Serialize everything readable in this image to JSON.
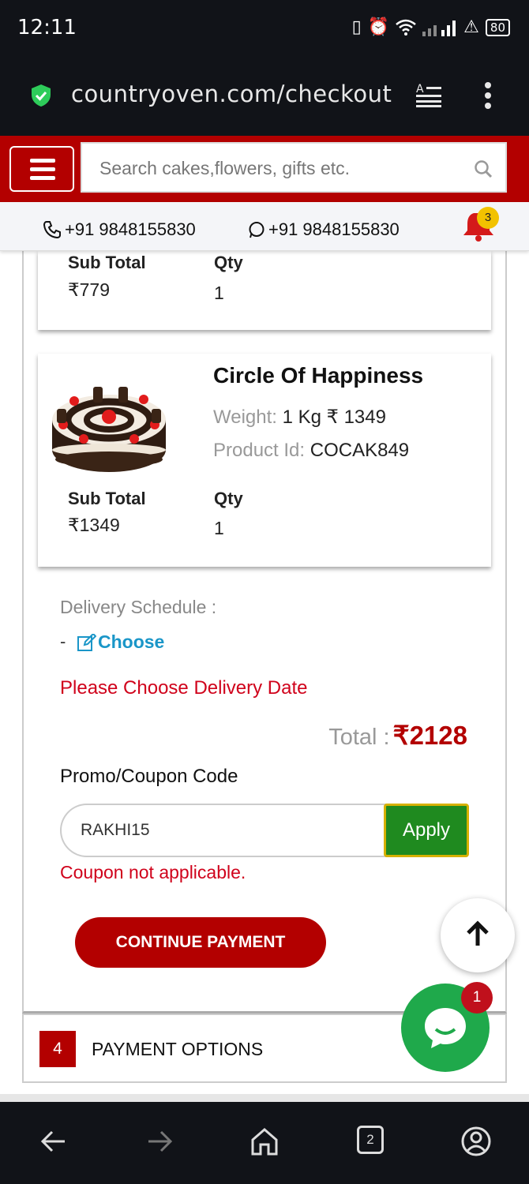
{
  "status_bar": {
    "time": "12:11",
    "battery": "80"
  },
  "browser": {
    "url": "countryoven.com/checkout"
  },
  "header": {
    "search_placeholder": "Search cakes,flowers, gifts etc."
  },
  "contact": {
    "phone": "+91 9848155830",
    "whatsapp": "+91 9848155830",
    "notification_count": "3"
  },
  "cart_items": [
    {
      "subtotal_label": "Sub Total",
      "subtotal": "₹779",
      "qty_label": "Qty",
      "qty": "1"
    },
    {
      "name": "Circle Of Happiness",
      "weight_label": "Weight:",
      "weight": "1 Kg ₹ 1349",
      "product_id_label": "Product Id:",
      "product_id": "COCAK849",
      "subtotal_label": "Sub Total",
      "subtotal": "₹1349",
      "qty_label": "Qty",
      "qty": "1"
    }
  ],
  "delivery": {
    "label": "Delivery Schedule :",
    "dash": "-",
    "choose_label": "Choose",
    "warning": "Please Choose Delivery Date"
  },
  "total": {
    "label": "Total :",
    "value": "₹2128"
  },
  "promo": {
    "label": "Promo/Coupon Code",
    "value": "RAKHI15",
    "apply_label": "Apply",
    "error": "Coupon not applicable."
  },
  "continue_label": "CONTINUE PAYMENT",
  "payment_section": {
    "step": "4",
    "title": "PAYMENT OPTIONS"
  },
  "chat": {
    "badge": "1"
  },
  "nav": {
    "tabs_count": "2"
  },
  "colors": {
    "brand_red": "#b30000",
    "apply_green": "#1f8a1f",
    "link_blue": "#1a96c8",
    "error_red": "#d0021b",
    "chat_green": "#1fa94b"
  }
}
